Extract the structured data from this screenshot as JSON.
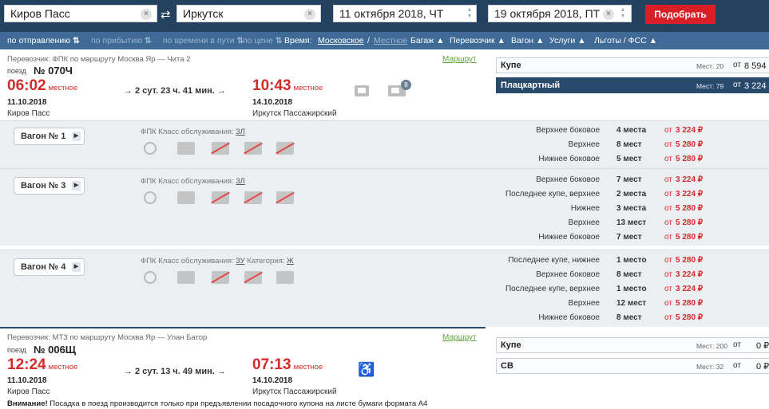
{
  "search": {
    "from": "Киров Пасс",
    "to": "Иркутск",
    "date_from": "11 октября 2018, ЧТ",
    "date_to": "19 октября 2018, ПТ",
    "submit_label": "Подобрать",
    "clear_glyph": "×",
    "swap_glyph": "⇄"
  },
  "filters": {
    "by_departure": "по отправлению",
    "by_arrival": "по прибытию",
    "by_travel_time": "по времени в пути",
    "by_price": "по цене",
    "time_label": "Время:",
    "time_moscow": "Московское",
    "time_slash": "/",
    "time_local": "Местное",
    "luggage": "Багаж",
    "carrier": "Перевозчик",
    "car": "Вагон",
    "services": "Услуги",
    "benefits": "Льготы / ФСС",
    "sort_glyph": "⇅",
    "caret": "▲"
  },
  "trains": [
    {
      "carrier_line": "Перевозчик: ФПК   по маршруту Москва Яр — Чита 2",
      "route_link": "Маршрут",
      "train_label": "поезд",
      "number": "№ 070Ч",
      "dep_time": "06:02",
      "dep_suffix": "местное",
      "dep_date": "11.10.2018",
      "dep_station": "Киров Пасс",
      "duration": "→  2 сут. 23 ч. 41 мин.  →",
      "arr_time": "10:43",
      "arr_suffix": "местное",
      "arr_date": "14.10.2018",
      "arr_station": "Иркутск Пассажирский",
      "wagon_count": "8",
      "classes": [
        {
          "name": "Купе",
          "seats": "Мест: 20",
          "from": "от",
          "price": "8 594 ₽"
        },
        {
          "name": "Плацкартный",
          "seats": "Мест: 79",
          "from": "от",
          "price": "3 224 ₽"
        }
      ],
      "wagons": [
        {
          "label": "Вагон № 1",
          "info": "ФПК   Класс обслуживания: ",
          "service_class": "3Л",
          "category_label": "",
          "category": "",
          "rows": [
            {
              "type": "Верхнее боковое",
              "count": "4 места",
              "from": "от",
              "price": "3 224 ₽"
            },
            {
              "type": "Верхнее",
              "count": "8 мест",
              "from": "от",
              "price": "5 280 ₽"
            },
            {
              "type": "Нижнее боковое",
              "count": "5 мест",
              "from": "от",
              "price": "5 280 ₽"
            }
          ]
        },
        {
          "label": "Вагон № 3",
          "info": "ФПК   Класс обслуживания: ",
          "service_class": "3Л",
          "category_label": "",
          "category": "",
          "rows": [
            {
              "type": "Верхнее боковое",
              "count": "7 мест",
              "from": "от",
              "price": "3 224 ₽"
            },
            {
              "type": "Последнее купе, верхнее",
              "count": "2 места",
              "from": "от",
              "price": "3 224 ₽"
            },
            {
              "type": "Нижнее",
              "count": "3 места",
              "from": "от",
              "price": "5 280 ₽"
            },
            {
              "type": "Верхнее",
              "count": "13 мест",
              "from": "от",
              "price": "5 280 ₽"
            },
            {
              "type": "Нижнее боковое",
              "count": "7 мест",
              "from": "от",
              "price": "5 280 ₽"
            }
          ]
        },
        {
          "label": "Вагон № 4",
          "info": "ФПК   Класс обслуживания: ",
          "service_class": "3У",
          "category_label": "   Категория: ",
          "category": "Ж",
          "rows": [
            {
              "type": "Последнее купе, нижнее",
              "count": "1 место",
              "from": "от",
              "price": "5 280 ₽"
            },
            {
              "type": "Верхнее боковое",
              "count": "8 мест",
              "from": "от",
              "price": "3 224 ₽"
            },
            {
              "type": "Последнее купе, верхнее",
              "count": "1 место",
              "from": "от",
              "price": "3 224 ₽"
            },
            {
              "type": "Верхнее",
              "count": "12 мест",
              "from": "от",
              "price": "5 280 ₽"
            },
            {
              "type": "Нижнее боковое",
              "count": "8 мест",
              "from": "от",
              "price": "5 280 ₽"
            }
          ]
        }
      ]
    },
    {
      "carrier_line": "Перевозчик: МТЗ   по маршруту Москва Яр — Улан Батор",
      "route_link": "Маршрут",
      "train_label": "поезд",
      "number": "№ 006Щ",
      "dep_time": "12:24",
      "dep_suffix": "местное",
      "dep_date": "11.10.2018",
      "dep_station": "Киров Пасс",
      "duration": "→  2 сут. 13 ч. 49 мин.  →",
      "arr_time": "07:13",
      "arr_suffix": "местное",
      "arr_date": "14.10.2018",
      "arr_station": "Иркутск Пассажирский",
      "classes": [
        {
          "name": "Купе",
          "seats": "Мест: 200",
          "from": "от",
          "price": "0 ₽"
        },
        {
          "name": "СВ",
          "seats": "Мест: 32",
          "from": "от",
          "price": "0 ₽"
        }
      ]
    }
  ],
  "warning": {
    "bold": "Внимание!",
    "text": " Посадка в поезд производится только при предъявлении посадочного купона на листе бумаги формата А4"
  },
  "icons": {
    "wheelchair": "♿",
    "triangle": "▶"
  }
}
